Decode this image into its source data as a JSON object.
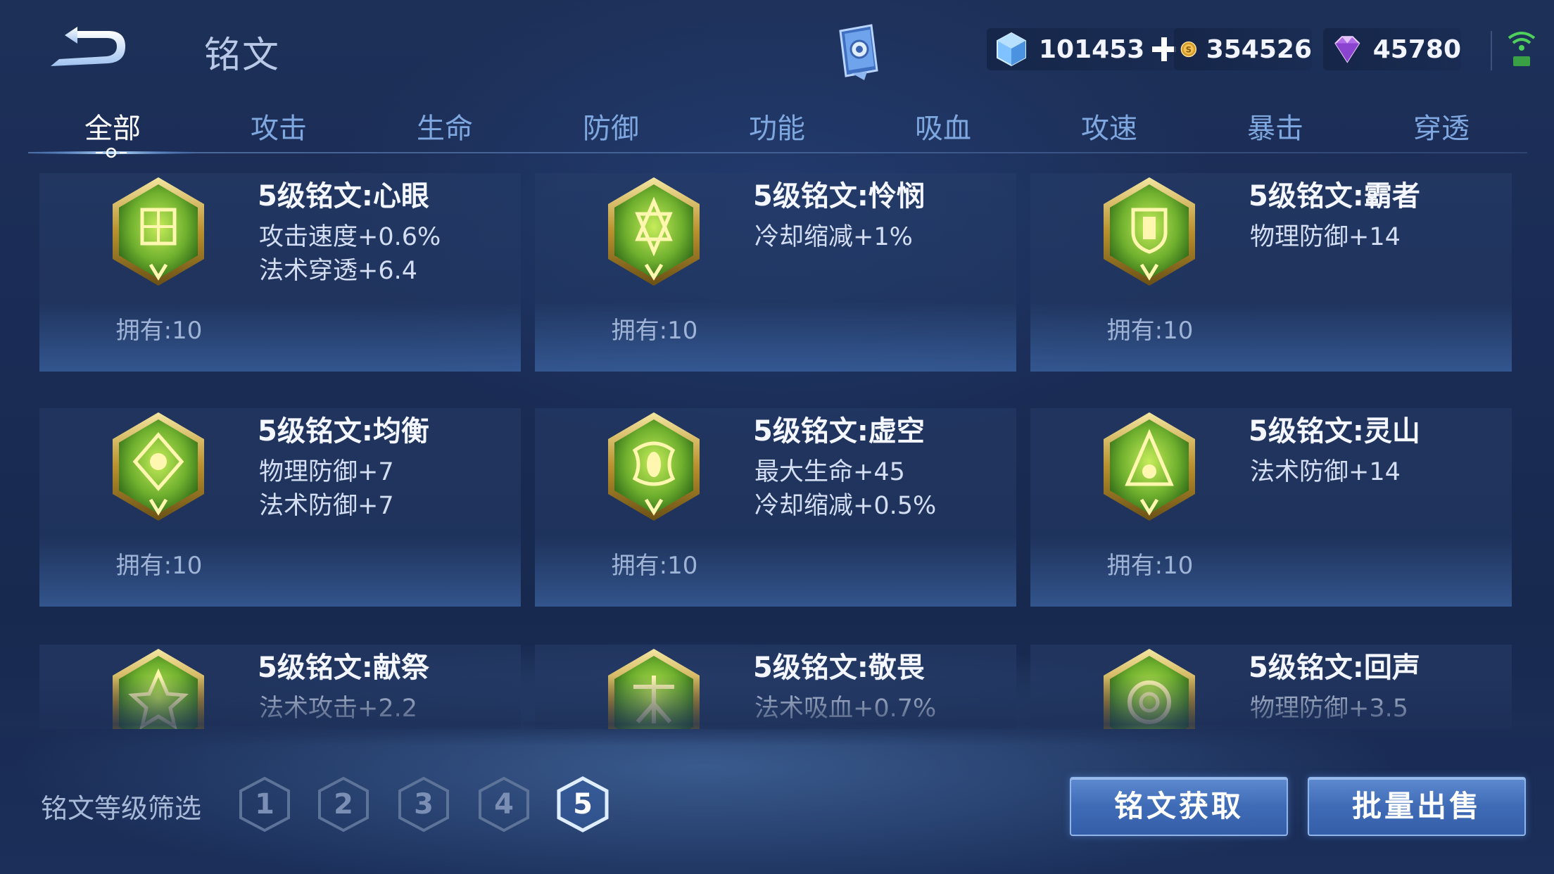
{
  "header": {
    "title": "铭文",
    "currencies": [
      {
        "icon": "blue-crystal-icon",
        "value": "101453"
      },
      {
        "icon": "gold-coin-icon",
        "value": "354526"
      },
      {
        "icon": "purple-gem-icon",
        "value": "45780"
      }
    ]
  },
  "tabs": [
    "全部",
    "攻击",
    "生命",
    "防御",
    "功能",
    "吸血",
    "攻速",
    "暴击",
    "穿透"
  ],
  "active_tab": 0,
  "runes": [
    {
      "name": "5级铭文:心眼",
      "stats": [
        "攻击速度+0.6%",
        "法术穿透+6.4"
      ],
      "owned": "拥有:10",
      "icon": "rune-xinyan-icon"
    },
    {
      "name": "5级铭文:怜悯",
      "stats": [
        "冷却缩减+1%"
      ],
      "owned": "拥有:10",
      "icon": "rune-lianmin-icon"
    },
    {
      "name": "5级铭文:霸者",
      "stats": [
        "物理防御+14"
      ],
      "owned": "拥有:10",
      "icon": "rune-bazhe-icon"
    },
    {
      "name": "5级铭文:均衡",
      "stats": [
        "物理防御+7",
        "法术防御+7"
      ],
      "owned": "拥有:10",
      "icon": "rune-junheng-icon"
    },
    {
      "name": "5级铭文:虚空",
      "stats": [
        "最大生命+45",
        "冷却缩减+0.5%"
      ],
      "owned": "拥有:10",
      "icon": "rune-xukong-icon"
    },
    {
      "name": "5级铭文:灵山",
      "stats": [
        "法术防御+14"
      ],
      "owned": "拥有:10",
      "icon": "rune-lingshan-icon"
    },
    {
      "name": "5级铭文:献祭",
      "stats": [
        "法术攻击+2.2"
      ],
      "icon": "rune-xianji-icon"
    },
    {
      "name": "5级铭文:敬畏",
      "stats": [
        "法术吸血+0.7%"
      ],
      "icon": "rune-jingwei-icon"
    },
    {
      "name": "5级铭文:回声",
      "stats": [
        "物理防御+3.5"
      ],
      "icon": "rune-huisheng-icon"
    }
  ],
  "footer": {
    "filter_label": "铭文等级筛选",
    "levels": [
      "1",
      "2",
      "3",
      "4",
      "5"
    ],
    "active_level": 4,
    "acquire_label": "铭文获取",
    "sell_label": "批量出售"
  }
}
